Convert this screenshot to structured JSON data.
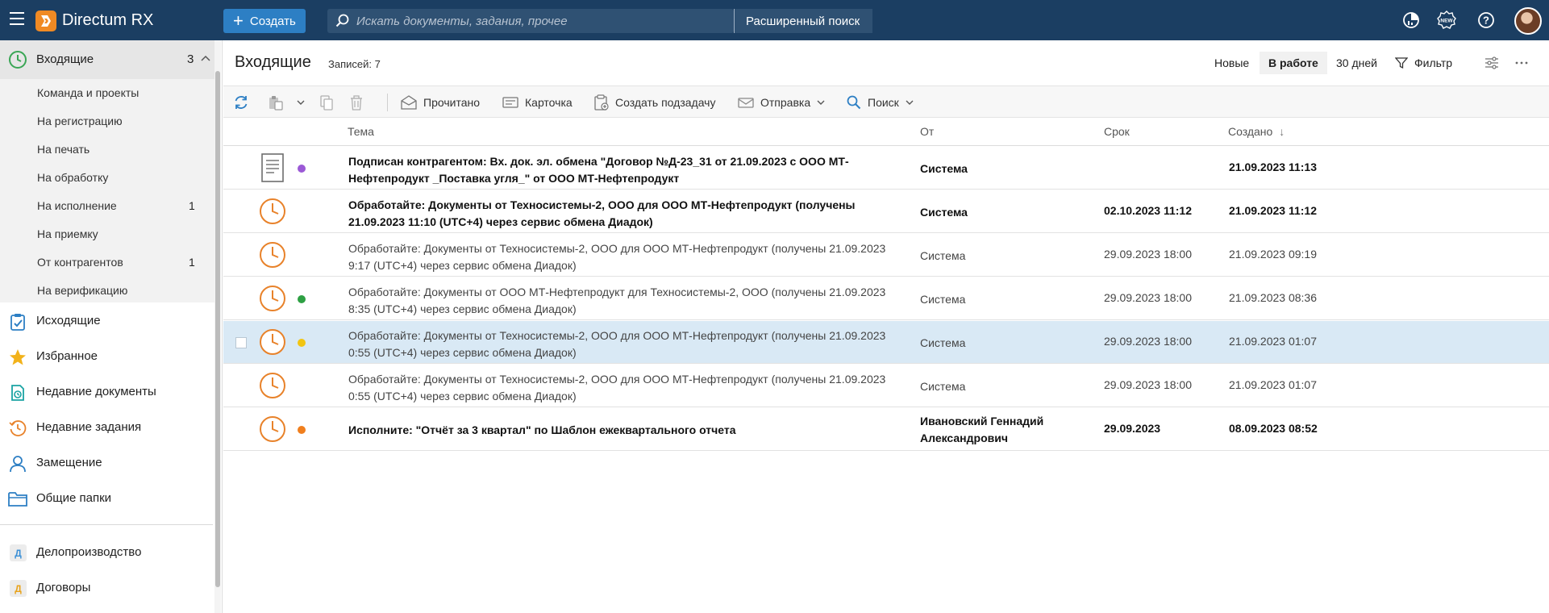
{
  "app": {
    "title": "Directum RX",
    "create_label": "Создать",
    "search_placeholder": "Искать документы, задания, прочее",
    "advanced_search_label": "Расширенный поиск",
    "top_icons": [
      "analytics-icon",
      "new-badge-icon",
      "help-icon",
      "user-avatar"
    ]
  },
  "sidebar": {
    "inbox": {
      "label": "Входящие",
      "count": "3"
    },
    "sub_items": [
      {
        "label": "Команда и проекты",
        "count": ""
      },
      {
        "label": "На регистрацию",
        "count": ""
      },
      {
        "label": "На печать",
        "count": ""
      },
      {
        "label": "На обработку",
        "count": ""
      },
      {
        "label": "На исполнение",
        "count": "1"
      },
      {
        "label": "На приемку",
        "count": ""
      },
      {
        "label": "От контрагентов",
        "count": "1"
      },
      {
        "label": "На верификацию",
        "count": ""
      }
    ],
    "nav_items": [
      {
        "label": "Исходящие",
        "icon": "outgoing-icon"
      },
      {
        "label": "Избранное",
        "icon": "star-icon"
      },
      {
        "label": "Недавние документы",
        "icon": "recent-documents-icon"
      },
      {
        "label": "Недавние задания",
        "icon": "recent-tasks-icon"
      },
      {
        "label": "Замещение",
        "icon": "substitution-icon"
      },
      {
        "label": "Общие папки",
        "icon": "folder-icon"
      }
    ],
    "modules": [
      {
        "badge": "Д",
        "label": "Делопроизводство",
        "badge_color": "#3a8fd6"
      },
      {
        "badge": "Д",
        "label": "Договоры",
        "badge_color": "#e8a21a"
      }
    ]
  },
  "main": {
    "title": "Входящие",
    "records": "Записей: 7",
    "tabs": [
      {
        "label": "Новые",
        "active": false
      },
      {
        "label": "В работе",
        "active": true
      },
      {
        "label": "30 дней",
        "active": false
      }
    ],
    "filter_label": "Фильтр",
    "toolbar": {
      "read_label": "Прочитано",
      "card_label": "Карточка",
      "subtask_label": "Создать подзадачу",
      "send_label": "Отправка",
      "search_label": "Поиск"
    },
    "columns": {
      "subject": "Тема",
      "from": "От",
      "due": "Срок",
      "created": "Создано",
      "sort_arrow": "↓"
    },
    "rows": [
      {
        "type": "document",
        "dot": "#9b59d6",
        "subject": "Подписан контрагентом: Вх. док. эл. обмена \"Договор №Д-23_31 от 21.09.2023 с ООО МТ-Нефтепродукт _Поставка угля_\" от ООО МТ-Нефтепродукт",
        "from": "Система",
        "due": "",
        "created": "21.09.2023 11:13",
        "unread": true,
        "selected": false
      },
      {
        "type": "task",
        "dot": "",
        "subject": "Обработайте: Документы от Техносистемы-2, ООО для ООО МТ-Нефтепродукт (получены 21.09.2023 11:10 (UTC+4) через сервис обмена Диадок)",
        "from": "Система",
        "due": "02.10.2023 11:12",
        "created": "21.09.2023 11:12",
        "unread": true,
        "selected": false
      },
      {
        "type": "task",
        "dot": "",
        "subject": "Обработайте: Документы от Техносистемы-2, ООО для ООО МТ-Нефтепродукт (получены 21.09.2023 9:17 (UTC+4) через сервис обмена Диадок)",
        "from": "Система",
        "due": "29.09.2023 18:00",
        "created": "21.09.2023 09:19",
        "unread": false,
        "selected": false
      },
      {
        "type": "task",
        "dot": "#2ea043",
        "subject": "Обработайте: Документы от ООО МТ-Нефтепродукт для Техносистемы-2, ООО (получены 21.09.2023 8:35 (UTC+4) через сервис обмена Диадок)",
        "from": "Система",
        "due": "29.09.2023 18:00",
        "created": "21.09.2023 08:36",
        "unread": false,
        "selected": false
      },
      {
        "type": "task",
        "dot": "#f2c511",
        "subject": "Обработайте: Документы от Техносистемы-2, ООО для ООО МТ-Нефтепродукт (получены 21.09.2023 0:55 (UTC+4) через сервис обмена Диадок)",
        "from": "Система",
        "due": "29.09.2023 18:00",
        "created": "21.09.2023 01:07",
        "unread": false,
        "selected": true
      },
      {
        "type": "task",
        "dot": "",
        "subject": "Обработайте: Документы от Техносистемы-2, ООО для ООО МТ-Нефтепродукт (получены 21.09.2023 0:55 (UTC+4) через сервис обмена Диадок)",
        "from": "Система",
        "due": "29.09.2023 18:00",
        "created": "21.09.2023 01:07",
        "unread": false,
        "selected": false
      },
      {
        "type": "task",
        "dot": "#f07f1e",
        "subject": "Исполните: \"Отчёт за 3 квартал\" по Шаблон ежеквартального отчета",
        "from": "Ивановский Геннадий Александрович",
        "due": "29.09.2023",
        "created": "08.09.2023 08:52",
        "unread": true,
        "selected": false
      }
    ]
  }
}
